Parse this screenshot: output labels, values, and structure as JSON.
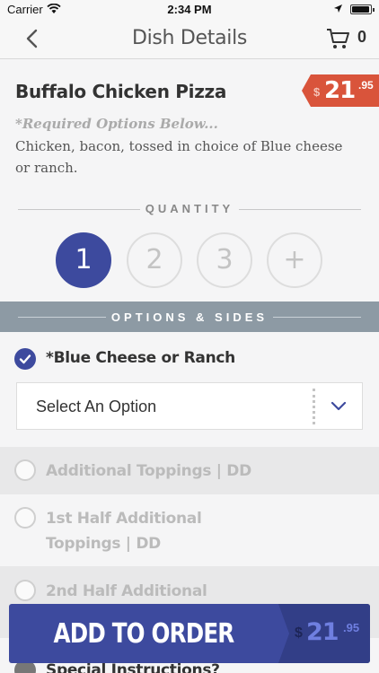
{
  "status_bar": {
    "carrier": "Carrier",
    "time": "2:34 PM"
  },
  "nav": {
    "title": "Dish Details",
    "cart_count": "0"
  },
  "dish": {
    "name": "Buffalo Chicken Pizza",
    "price": {
      "currency": "$",
      "whole": "21",
      "cents": ".95"
    },
    "required_note": "*Required Options Below...",
    "description": "Chicken, bacon, tossed in choice of Blue cheese or ranch."
  },
  "quantity": {
    "label": "QUANTITY",
    "options": [
      "1",
      "2",
      "3",
      "+"
    ],
    "selected": "1"
  },
  "options_section": {
    "label": "OPTIONS & SIDES"
  },
  "options": [
    {
      "title": "*Blue Cheese or Ranch",
      "checked": true,
      "select_value": "Select An Option"
    },
    {
      "title": "Additional Toppings | DD",
      "checked": false
    },
    {
      "title": "1st Half Additional Toppings | DD",
      "checked": false
    },
    {
      "title": "2nd Half Additional",
      "checked": false
    },
    {
      "title": "Special Instructions?",
      "checked": false
    }
  ],
  "add_to_order": {
    "label": "ADD TO ORDER",
    "price": {
      "currency": "$",
      "whole": "21",
      "cents": ".95"
    }
  },
  "colors": {
    "accent": "#3d4a9e",
    "price_tag": "#d9543b",
    "section_bar": "#8d9aa4"
  }
}
